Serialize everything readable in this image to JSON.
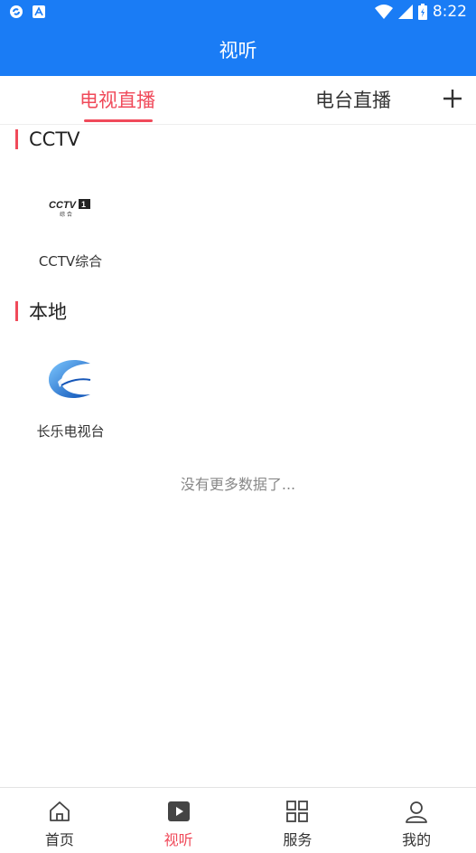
{
  "status": {
    "time": "8:22"
  },
  "appbar": {
    "title": "视听"
  },
  "tabs": [
    {
      "label": "电视直播",
      "active": true
    },
    {
      "label": "电台直播",
      "active": false
    }
  ],
  "sections": [
    {
      "title": "CCTV",
      "channels": [
        {
          "name": "CCTV综合",
          "logo_icon": "cctv1-logo-icon"
        }
      ]
    },
    {
      "title": "本地",
      "channels": [
        {
          "name": "长乐电视台",
          "logo_icon": "changle-tv-logo-icon"
        }
      ]
    }
  ],
  "no_more": "没有更多数据了...",
  "bottom_nav": [
    {
      "label": "首页",
      "icon": "home-icon"
    },
    {
      "label": "视听",
      "icon": "play-icon",
      "active": true
    },
    {
      "label": "服务",
      "icon": "grid-icon"
    },
    {
      "label": "我的",
      "icon": "user-icon"
    }
  ],
  "colors": {
    "primary": "#1a7cf5",
    "accent": "#f04a5a"
  }
}
